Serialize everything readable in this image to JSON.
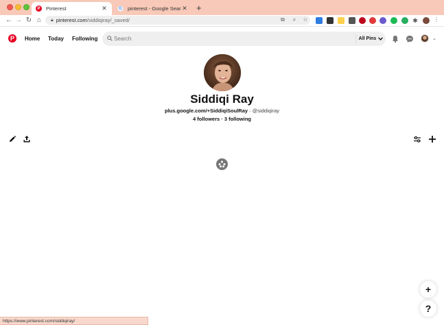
{
  "browser": {
    "tabs": [
      {
        "title": "Pinterest",
        "active": true
      },
      {
        "title": "pinterest - Google Search",
        "active": false
      }
    ],
    "url_host": "pinterest.com",
    "url_path": "/siddiqiray/_saved/",
    "status_url": "https://www.pinterest.com/siddiqiray/"
  },
  "header": {
    "nav": {
      "home": "Home",
      "today": "Today",
      "following": "Following"
    },
    "search_placeholder": "Search",
    "filter_label": "All Pins",
    "brand_color": "#e60023"
  },
  "profile": {
    "name": "Siddiqi Ray",
    "website": "plus.google.com/+SiddiqiSoulRay",
    "separator": " · ",
    "handle": "@siddiqiray",
    "followers": "4 followers",
    "stats_separator": " · ",
    "following": "3 following"
  },
  "fab": {
    "add": "+",
    "help": "?"
  }
}
